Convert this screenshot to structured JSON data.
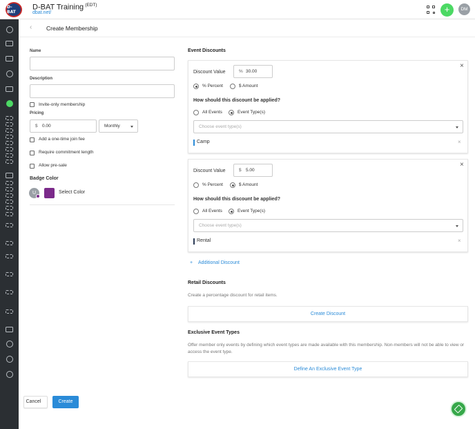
{
  "app": {
    "logo_text": "D-BAT",
    "title": "D-BAT Training",
    "timezone": "(EDT)",
    "subdomain": "dbat.net/",
    "user_initials": "DM",
    "plus_label": "+"
  },
  "page": {
    "title": "Create Membership"
  },
  "form": {
    "name_label": "Name",
    "name_value": "",
    "description_label": "Description",
    "description_value": "",
    "invite_only_label": "Invite-only membership",
    "pricing_label": "Pricing",
    "price_currency": "$",
    "price_value": "0.00",
    "price_period": "Monthly",
    "join_fee_label": "Add a one-time join fee",
    "commitment_label": "Require commitment length",
    "presale_label": "Allow pre-sale",
    "badge_color_label": "Badge Color",
    "badge_initial": "U",
    "badge_color": "#7b2a8a",
    "select_color_label": "Select Color"
  },
  "event_discounts": {
    "title": "Event Discounts",
    "cards": [
      {
        "discount_label": "Discount Value",
        "prefix": "%",
        "value": "30.00",
        "percent_label": "% Percent",
        "amount_label": "$ Amount",
        "selected_type": "percent",
        "question": "How should this discount be applied?",
        "all_events_label": "All Events",
        "event_types_label": "Event Type(s)",
        "placeholder": "Choose event type(s)",
        "tag": "Camp",
        "tag_color": "#2a8bd8"
      },
      {
        "discount_label": "Discount Value",
        "prefix": "$",
        "value": "5.00",
        "percent_label": "% Percent",
        "amount_label": "$ Amount",
        "selected_type": "amount",
        "question": "How should this discount be applied?",
        "all_events_label": "All Events",
        "event_types_label": "Event Type(s)",
        "placeholder": "Choose event type(s)",
        "tag": "Rental",
        "tag_color": "#2b3a55"
      }
    ],
    "additional_label": "Additional Discount"
  },
  "retail": {
    "title": "Retail Discounts",
    "description": "Create a percentage discount for retail items.",
    "button": "Create Discount"
  },
  "exclusive": {
    "title": "Exclusive Event Types",
    "description": "Offer member only events by defining which event types are made available with this membership. Non-members will not be able to view or access the event type.",
    "button": "Define An Exclusive Event Type"
  },
  "footer": {
    "cancel": "Cancel",
    "create": "Create"
  },
  "colors": {
    "accent": "#2a8bd8",
    "success": "#4cd964",
    "sidebar": "#2b2f33"
  }
}
